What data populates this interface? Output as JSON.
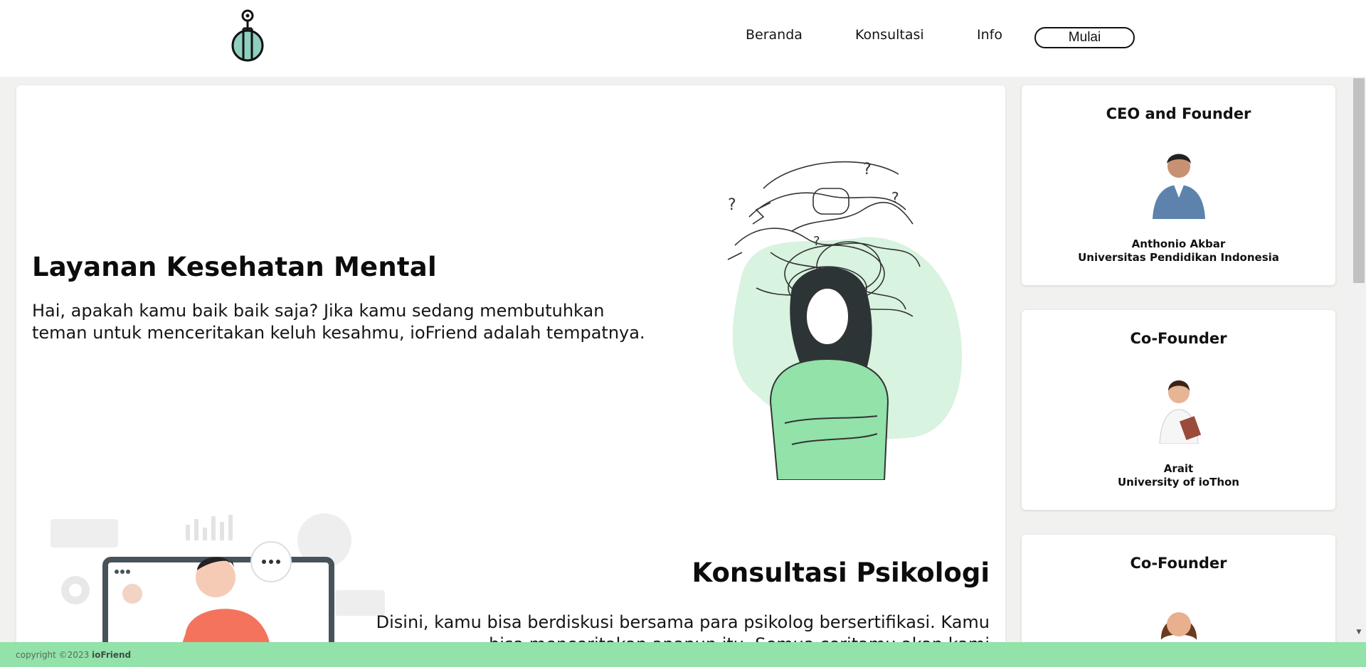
{
  "header": {
    "logo": "bulb-logo-icon",
    "nav": [
      {
        "label": "Beranda"
      },
      {
        "label": "Konsultasi"
      },
      {
        "label": "Info"
      }
    ],
    "cta_label": "Mulai"
  },
  "hero": {
    "title": "Layanan Kesehatan Mental",
    "text": "Hai, apakah kamu baik baik saja? Jika kamu sedang membutuhkan teman untuk menceritakan keluh kesahmu, ioFriend adalah tempatnya.",
    "illustration": "anxious-woman-illustration"
  },
  "section2": {
    "title": "Konsultasi Psikologi",
    "text": "Disini, kamu bisa berdiskusi bersama para psikolog bersertifikasi. Kamu bisa menceritakan apapun itu. Semua ceritamu akan kami",
    "illustration": "online-consultation-illustration"
  },
  "team": [
    {
      "role": "CEO and Founder",
      "name": "Anthonio Akbar",
      "org": "Universitas Pendidikan Indonesia"
    },
    {
      "role": "Co-Founder",
      "name": "Arait",
      "org": "University of ioThon"
    },
    {
      "role": "Co-Founder",
      "name": "",
      "org": ""
    }
  ],
  "footer": {
    "copyright": "copyright ©2023 ",
    "brand": "ioFriend"
  },
  "colors": {
    "accent_green": "#92e2aa",
    "logo_teal": "#8fcfc0"
  }
}
